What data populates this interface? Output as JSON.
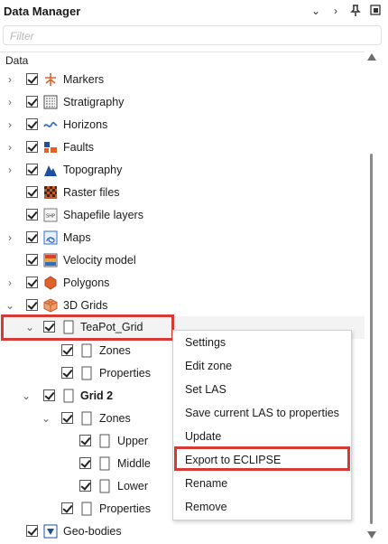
{
  "window": {
    "title": "Data Manager"
  },
  "filter": {
    "placeholder": "Filter"
  },
  "tree_header": {
    "label": "Data"
  },
  "tree": [
    {
      "label": "Markers"
    },
    {
      "label": "Stratigraphy"
    },
    {
      "label": "Horizons"
    },
    {
      "label": "Faults"
    },
    {
      "label": "Topography"
    },
    {
      "label": "Raster files"
    },
    {
      "label": "Shapefile layers"
    },
    {
      "label": "Maps"
    },
    {
      "label": "Velocity model"
    },
    {
      "label": "Polygons"
    },
    {
      "label": "3D Grids"
    },
    {
      "label": "TeaPot_Grid"
    },
    {
      "label": "Zones"
    },
    {
      "label": "Properties"
    },
    {
      "label": "Grid 2"
    },
    {
      "label": "Zones"
    },
    {
      "label": "Upper"
    },
    {
      "label": "Middle"
    },
    {
      "label": "Lower"
    },
    {
      "label": "Properties"
    },
    {
      "label": "Geo-bodies"
    }
  ],
  "context_menu": [
    {
      "label": "Settings"
    },
    {
      "label": "Edit zone"
    },
    {
      "label": "Set LAS"
    },
    {
      "label": "Save current LAS to properties"
    },
    {
      "label": "Update"
    },
    {
      "label": "Export to ECLIPSE"
    },
    {
      "label": "Rename"
    },
    {
      "label": "Remove"
    }
  ],
  "icons": {
    "collapse": "chevron-down-icon",
    "next": "chevron-right-icon",
    "pin": "pin-icon",
    "float": "float-window-icon"
  },
  "colors": {
    "highlight": "#d63a35",
    "selection_bg": "#f3f3f3"
  }
}
